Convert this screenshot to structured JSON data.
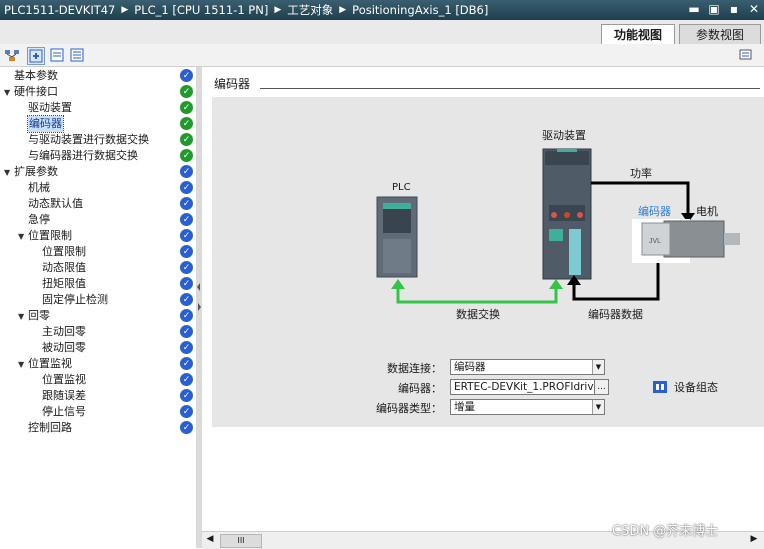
{
  "window": {
    "breadcrumbs": [
      "PLC1511-DEVKIT47",
      "PLC_1 [CPU 1511-1 PN]",
      "工艺对象",
      "PositioningAxis_1 [DB6]"
    ],
    "controls": [
      "▬",
      "▣",
      "▪",
      "✕"
    ]
  },
  "tabs": [
    {
      "label": "功能视图",
      "active": true
    },
    {
      "label": "参数视图",
      "active": false
    }
  ],
  "tree": [
    {
      "label": "基本参数",
      "level": 0,
      "status": "blue"
    },
    {
      "label": "硬件接口",
      "level": 0,
      "expanded": true,
      "status": "ok"
    },
    {
      "label": "驱动装置",
      "level": 1,
      "status": "ok"
    },
    {
      "label": "编码器",
      "level": 1,
      "status": "ok",
      "selected": true
    },
    {
      "label": "与驱动装置进行数据交换",
      "level": 1,
      "status": "ok"
    },
    {
      "label": "与编码器进行数据交换",
      "level": 1,
      "status": "ok"
    },
    {
      "label": "扩展参数",
      "level": 0,
      "expanded": true,
      "status": "blue"
    },
    {
      "label": "机械",
      "level": 1,
      "status": "blue"
    },
    {
      "label": "动态默认值",
      "level": 1,
      "status": "blue"
    },
    {
      "label": "急停",
      "level": 1,
      "status": "blue"
    },
    {
      "label": "位置限制",
      "level": 1,
      "expanded": true,
      "status": "blue"
    },
    {
      "label": "位置限制",
      "level": 2,
      "status": "blue"
    },
    {
      "label": "动态限值",
      "level": 2,
      "status": "blue"
    },
    {
      "label": "扭矩限值",
      "level": 2,
      "status": "blue"
    },
    {
      "label": "固定停止检测",
      "level": 2,
      "status": "blue"
    },
    {
      "label": "回零",
      "level": 1,
      "expanded": true,
      "status": "blue"
    },
    {
      "label": "主动回零",
      "level": 2,
      "status": "blue"
    },
    {
      "label": "被动回零",
      "level": 2,
      "status": "blue"
    },
    {
      "label": "位置监视",
      "level": 1,
      "expanded": true,
      "status": "blue"
    },
    {
      "label": "位置监视",
      "level": 2,
      "status": "blue"
    },
    {
      "label": "跟随误差",
      "level": 2,
      "status": "blue"
    },
    {
      "label": "停止信号",
      "level": 2,
      "status": "blue"
    },
    {
      "label": "控制回路",
      "level": 1,
      "status": "blue"
    }
  ],
  "content": {
    "section_title": "编码器",
    "diagram": {
      "plc_label": "PLC",
      "drive_label": "驱动装置",
      "power_label": "功率",
      "encoder_label": "编码器",
      "motor_label": "电机",
      "data_exchange_label": "数据交换",
      "encoder_data_label": "编码器数据"
    },
    "fields": {
      "data_connection": {
        "label": "数据连接：",
        "value": "编码器"
      },
      "encoder": {
        "label": "编码器：",
        "value": "ERTEC-DEVKit_1.PROFIdrive Mo",
        "button": "..."
      },
      "encoder_type": {
        "label": "编码器类型：",
        "value": "增量"
      }
    },
    "device_config_label": "设备组态"
  },
  "scrollbar": {
    "grip": "III"
  },
  "watermark": "CSDN @芥末博士",
  "colors": {
    "accent_green": "#35c44a",
    "ok": "#1f9a2d",
    "pending": "#2a5fd1",
    "titlebar": "#1f3e4e"
  }
}
